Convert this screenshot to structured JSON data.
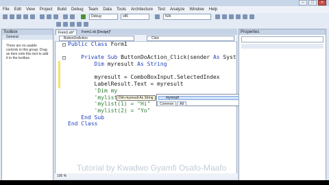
{
  "menu": [
    "File",
    "Edit",
    "View",
    "Project",
    "Build",
    "Debug",
    "Team",
    "Data",
    "Tools",
    "Architecture",
    "Test",
    "Analyze",
    "Window",
    "Help"
  ],
  "toolbar": {
    "config_combo": "Debug",
    "platform_combo": "x86",
    "find_combo": "N/A"
  },
  "toolbox": {
    "title": "Toolbox",
    "section": "General",
    "message": "There are no usable controls in this group. Drag an item onto this text to add it to the toolbox."
  },
  "editor": {
    "tabs": [
      "Form1.vb*",
      "Form1.vb [Design]*"
    ],
    "nav_left": "ButtonDoAction",
    "nav_right": "Click",
    "zoom": "100 %",
    "code_lines": [
      [
        {
          "t": "Public Class Form1",
          "c": "kw-mixed"
        }
      ],
      [],
      [
        {
          "t": "    Private Sub ButtonDoAction_Click(sender As Syst",
          "c": "sub"
        }
      ],
      [
        {
          "t": "        Dim myresult As String",
          "c": "dim"
        }
      ],
      [],
      [
        {
          "t": "        myresult = ComboBoxInput.SelectedIndex",
          "c": "plain"
        }
      ],
      [
        {
          "t": "        LabelResult.Text = myresult",
          "c": "plain"
        }
      ],
      [
        {
          "t": "        'Dim my",
          "c": "cmt"
        }
      ],
      [
        {
          "t": "        'mylist(0) = \"Hello\"",
          "c": "cmt"
        }
      ],
      [
        {
          "t": "        'mylist(1) = \"Hi\"",
          "c": "cmt"
        }
      ],
      [
        {
          "t": "        'mylist(2) = \"Yo\"",
          "c": "cmt"
        }
      ],
      [
        {
          "t": "    End Sub",
          "c": "kw"
        }
      ],
      [
        {
          "t": "End Class",
          "c": "kw"
        }
      ]
    ]
  },
  "tooltip": "Dim myresult As String",
  "intellisense": {
    "item": "myresult",
    "tabs": [
      "Common",
      "All"
    ]
  },
  "properties": {
    "title": "Properties"
  },
  "watermark": "Tutorial by Kwadwo Gyamfi Osafo-Maafo"
}
